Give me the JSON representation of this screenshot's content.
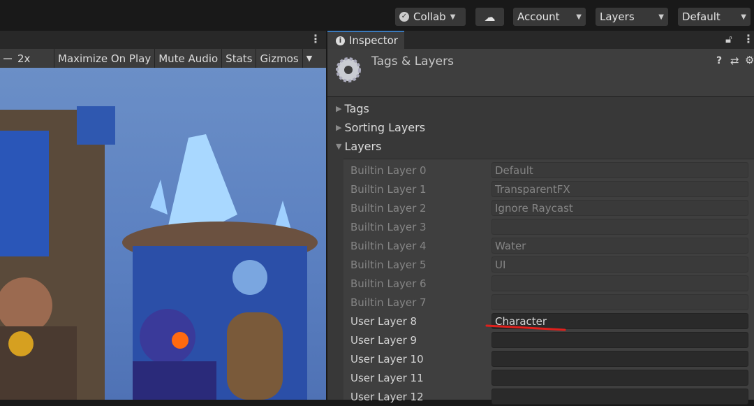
{
  "toolbar": {
    "collab": "Collab",
    "account": "Account",
    "layers": "Layers",
    "layout": "Default"
  },
  "game": {
    "scale": "2x",
    "maximize": "Maximize On Play",
    "mute": "Mute Audio",
    "stats": "Stats",
    "gizmos": "Gizmos"
  },
  "inspector": {
    "tab": "Inspector",
    "title": "Tags & Layers",
    "foldouts": [
      "Tags",
      "Sorting Layers",
      "Layers"
    ],
    "layers": [
      {
        "label": "Builtin Layer 0",
        "value": "Default",
        "builtin": true
      },
      {
        "label": "Builtin Layer 1",
        "value": "TransparentFX",
        "builtin": true
      },
      {
        "label": "Builtin Layer 2",
        "value": "Ignore Raycast",
        "builtin": true
      },
      {
        "label": "Builtin Layer 3",
        "value": "",
        "builtin": true
      },
      {
        "label": "Builtin Layer 4",
        "value": "Water",
        "builtin": true
      },
      {
        "label": "Builtin Layer 5",
        "value": "UI",
        "builtin": true
      },
      {
        "label": "Builtin Layer 6",
        "value": "",
        "builtin": true
      },
      {
        "label": "Builtin Layer 7",
        "value": "",
        "builtin": true
      },
      {
        "label": "User Layer 8",
        "value": "Character",
        "builtin": false
      },
      {
        "label": "User Layer 9",
        "value": "",
        "builtin": false
      },
      {
        "label": "User Layer 10",
        "value": "",
        "builtin": false
      },
      {
        "label": "User Layer 11",
        "value": "",
        "builtin": false
      },
      {
        "label": "User Layer 12",
        "value": "",
        "builtin": false
      }
    ]
  },
  "colors": {
    "accent": "#3a79bb",
    "annotation": "#e0201c"
  }
}
